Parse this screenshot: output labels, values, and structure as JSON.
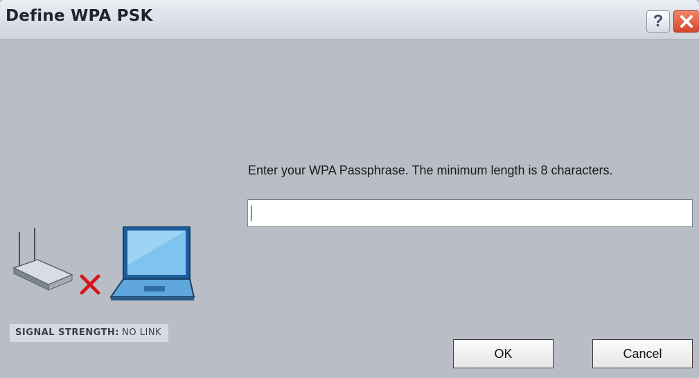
{
  "window": {
    "title": "Define WPA PSK",
    "help_glyph": "?",
    "close_icon": "close-icon"
  },
  "left_panel": {
    "signal_label": "SIGNAL STRENGTH:",
    "signal_value": "NO LINK",
    "graphic": {
      "router_icon": "router-icon",
      "disconnect_icon": "red-x-icon",
      "laptop_icon": "laptop-icon"
    }
  },
  "form": {
    "prompt": "Enter your WPA Passphrase.  The minimum length is 8 characters.",
    "passphrase_value": "",
    "passphrase_placeholder": ""
  },
  "buttons": {
    "ok": "OK",
    "cancel": "Cancel"
  },
  "colors": {
    "dialog_bg": "#b9bec6",
    "close_red": "#d5452a",
    "x_mark_red": "#d6161d"
  }
}
